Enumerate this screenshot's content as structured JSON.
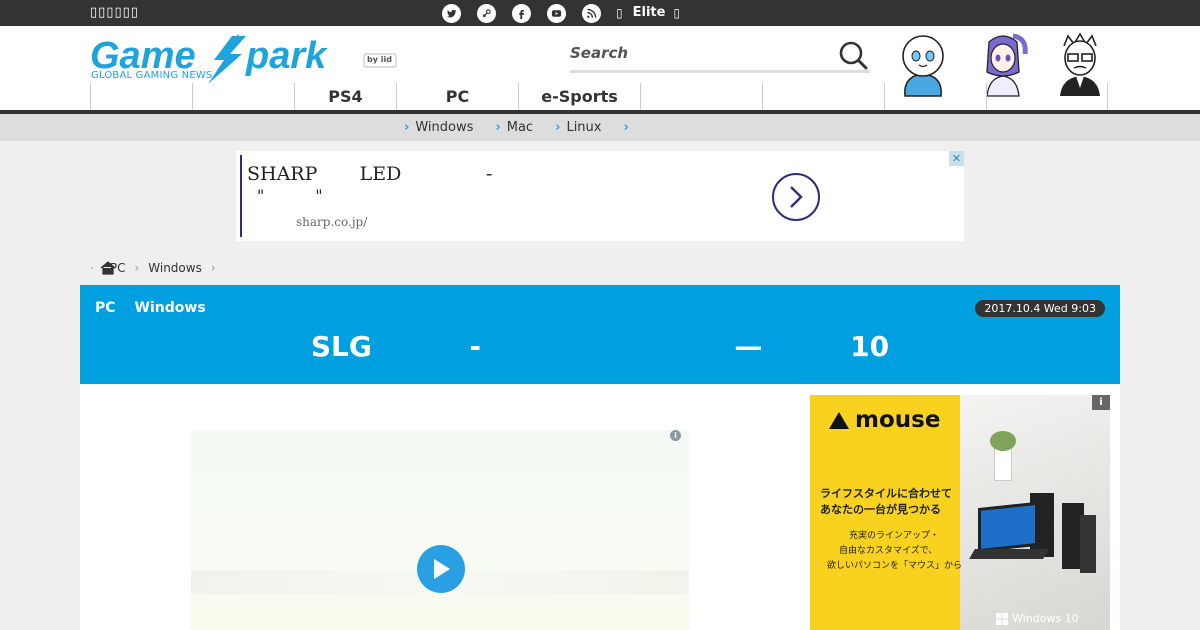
{
  "topbar": {
    "site_label": "▯▯▯▯▯▯",
    "social_icons": [
      "twitter-icon",
      "steam-icon",
      "facebook-icon",
      "youtube-icon",
      "rss-icon"
    ],
    "elite_label": "Elite",
    "elite_prefix": "▯",
    "elite_suffix": "▯"
  },
  "header": {
    "logo_sub": "GLOBAL GAMING NEWS",
    "logo_byline": "by iid",
    "search_placeholder": "Search"
  },
  "mainnav": {
    "items": [
      "",
      "",
      "PS4",
      "PC",
      "e-Sports",
      "",
      "",
      "",
      ""
    ]
  },
  "subnav": {
    "items": [
      "Windows",
      "Mac",
      "Linux",
      ""
    ]
  },
  "ad_banner": {
    "line1": "SHARP       LED              -",
    "line2": "\"          \"",
    "url": "sharp.co.jp/"
  },
  "breadcrumb": {
    "items": [
      "PC",
      "Windows"
    ]
  },
  "article": {
    "categories": [
      "PC",
      "Windows"
    ],
    "date": "2017.10.4 Wed 9:03",
    "title": "SLG          -                          —         10"
  },
  "side_ad": {
    "brand": "mouse",
    "copy1_line1": "ライフスタイルに合わせて",
    "copy1_line2": "あなたの一台が見つかる",
    "copy2_line1": "充実のラインアップ・",
    "copy2_line2": "自由なカスタマイズで、",
    "copy2_line3": "欲しいパソコンを「マウス」から",
    "windows_label": "Windows 10",
    "info_badge": "i"
  },
  "video": {
    "info_badge": "i"
  },
  "colors": {
    "accent": "#00a0e0",
    "topbar": "#333333",
    "ad_yellow": "#f8d21f"
  }
}
